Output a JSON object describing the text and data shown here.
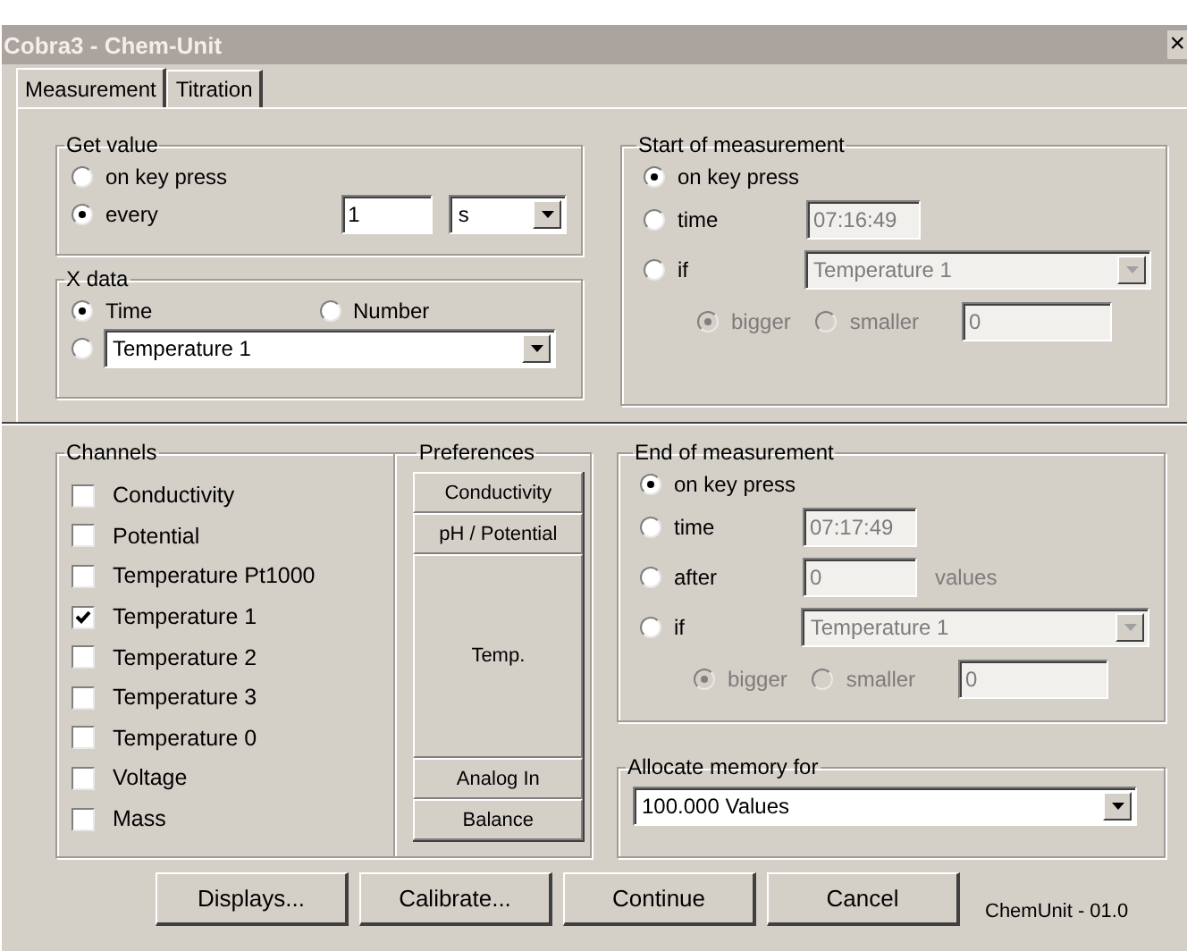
{
  "window": {
    "title": "Cobra3 - Chem-Unit",
    "close": "×"
  },
  "tabs": [
    {
      "label": "Measurement",
      "selected": true
    },
    {
      "label": "Titration",
      "selected": false
    }
  ],
  "get_value": {
    "title": "Get value",
    "options": [
      {
        "kind": "plain",
        "label": "on key press",
        "selected": false
      },
      {
        "kind": "interval",
        "label": "every",
        "selected": true,
        "field": {
          "value": "1"
        },
        "unit": {
          "value": "s"
        }
      }
    ]
  },
  "x_data": {
    "title": "X data",
    "options": [
      {
        "label": "Time",
        "selected": true
      },
      {
        "label": "Number",
        "selected": false
      }
    ],
    "channel_option": {
      "selected": false,
      "value": "Temperature 1"
    }
  },
  "start": {
    "title": "Start of measurement",
    "options": [
      {
        "kind": "plain",
        "label": "on key press",
        "selected": true
      },
      {
        "kind": "time",
        "label": "time",
        "selected": false,
        "field": {
          "value": "07:16:49",
          "disabled": true
        }
      },
      {
        "kind": "condition",
        "label": "if",
        "selected": false,
        "field": {
          "value": "Temperature 1",
          "disabled": true
        }
      }
    ],
    "compare": [
      {
        "label": "bigger",
        "selected": true,
        "disabled": true
      },
      {
        "label": "smaller",
        "selected": false,
        "disabled": true
      }
    ],
    "threshold": {
      "value": "0",
      "disabled": true
    }
  },
  "channels": {
    "title": "Channels",
    "items": [
      {
        "label": "Conductivity",
        "checked": false
      },
      {
        "label": "Potential",
        "checked": false
      },
      {
        "label": "Temperature Pt1000",
        "checked": false
      },
      {
        "label": "Temperature 1",
        "checked": true
      },
      {
        "label": "Temperature 2",
        "checked": false
      },
      {
        "label": "Temperature 3",
        "checked": false
      },
      {
        "label": "Temperature 0",
        "checked": false
      },
      {
        "label": "Voltage",
        "checked": false
      },
      {
        "label": "Mass",
        "checked": false
      }
    ]
  },
  "preferences": {
    "title": "Preferences",
    "buttons": [
      {
        "label": "Conductivity",
        "kind": "normal"
      },
      {
        "label": "pH / Potential",
        "kind": "normal"
      },
      {
        "label": "Temp.",
        "kind": "tall"
      },
      {
        "label": "Analog In",
        "kind": "normal"
      },
      {
        "label": "Balance",
        "kind": "normal"
      }
    ]
  },
  "end": {
    "title": "End of measurement",
    "options": [
      {
        "kind": "plain",
        "label": "on key press",
        "selected": true
      },
      {
        "kind": "time",
        "label": "time",
        "selected": false,
        "field": {
          "value": "07:17:49",
          "disabled": true
        }
      },
      {
        "kind": "count",
        "label": "after",
        "selected": false,
        "field": {
          "value": "0",
          "disabled": true
        },
        "unit": "values"
      },
      {
        "kind": "condition",
        "label": "if",
        "selected": false,
        "field": {
          "value": "Temperature 1",
          "disabled": true
        }
      }
    ],
    "compare": [
      {
        "label": "bigger",
        "selected": true,
        "disabled": true
      },
      {
        "label": "smaller",
        "selected": false,
        "disabled": true
      }
    ],
    "threshold": {
      "value": "0",
      "disabled": true
    }
  },
  "memory": {
    "title": "Allocate memory for",
    "value": "100.000 Values"
  },
  "buttons": [
    "Displays...",
    "Calibrate...",
    "Continue",
    "Cancel"
  ],
  "version": "ChemUnit - 01.0"
}
